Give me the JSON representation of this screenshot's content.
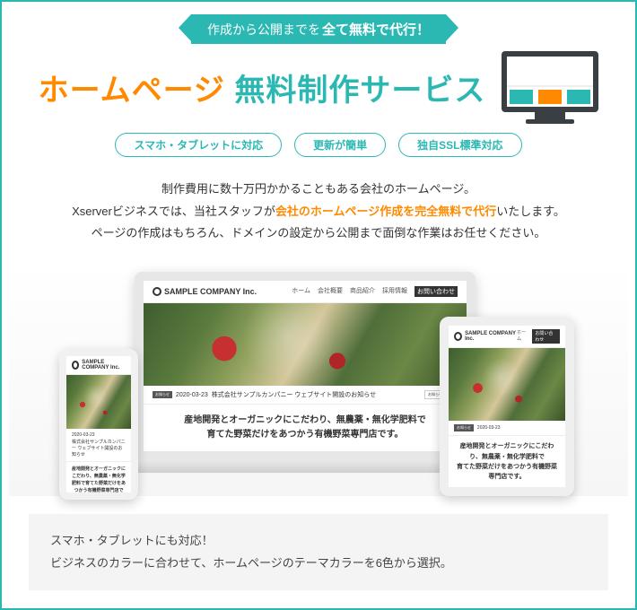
{
  "ribbon": {
    "pre": "作成から公開までを",
    "em": "全て無料で代行！"
  },
  "title": {
    "accent": "ホームページ",
    "rest": " 無料制作サービス"
  },
  "pills": [
    "スマホ・タブレットに対応",
    "更新が簡単",
    "独自SSL標準対応"
  ],
  "desc": {
    "l1": "制作費用に数十万円かかることもある会社のホームページ。",
    "l2a": "Xserverビジネスでは、当社スタッフが",
    "l2b": "会社のホームページ作成を完全無料で代行",
    "l2c": "いたします。",
    "l3": "ページの作成はもちろん、ドメインの設定から公開まで面倒な作業はお任せください。"
  },
  "sample": {
    "company": "SAMPLE COMPANY Inc.",
    "nav": [
      "ホーム",
      "会社概要",
      "商品紹介",
      "採用情報",
      "お問い合わせ"
    ],
    "news_label": "お知らせ",
    "news_date": "2020-03-23",
    "news_text": "株式会社サンプルカンパニー ウェブサイト開設のお知らせ",
    "news_more": "お知らせ一覧 ▶",
    "catch1": "産地開発とオーガニックにこだわり、無農薬・無化学肥料で",
    "catch2": "育てた野菜だけをあつかう有機野菜専門店です。",
    "catch_phone": "産地開発とオーガニックにこだわり、無農薬・無化学肥料で育てた野菜だけをあつかう有機野菜専門店です。"
  },
  "bottom": {
    "l1": "スマホ・タブレットにも対応！",
    "l2": "ビジネスのカラーに合わせて、ホームページのテーマカラーを6色から選択。"
  }
}
